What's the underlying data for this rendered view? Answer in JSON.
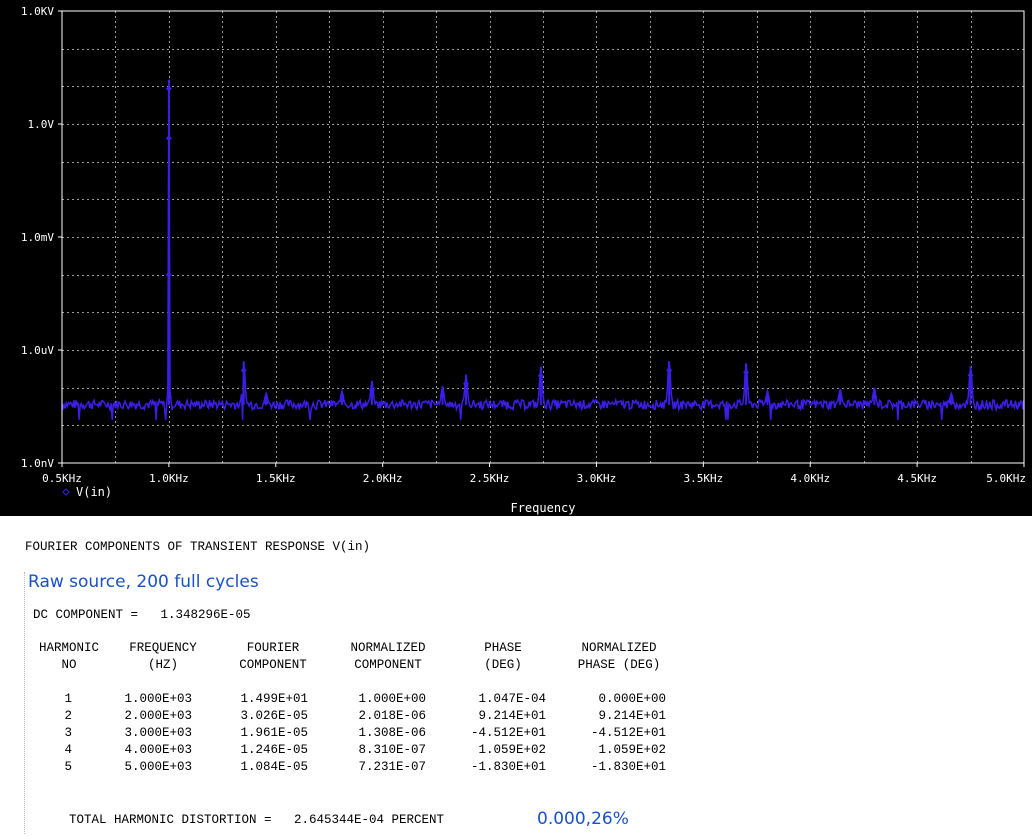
{
  "chart_data": {
    "type": "line",
    "title": "",
    "xlabel": "Frequency",
    "ylabel": "",
    "x_unit": "Hz",
    "y_scale": "log",
    "xlim": [
      500,
      5000
    ],
    "ylim": [
      1e-09,
      1000
    ],
    "x_ticks": [
      {
        "value": 500,
        "label": "0.5KHz"
      },
      {
        "value": 1000,
        "label": "1.0KHz"
      },
      {
        "value": 1500,
        "label": "1.5KHz"
      },
      {
        "value": 2000,
        "label": "2.0KHz"
      },
      {
        "value": 2500,
        "label": "2.5KHz"
      },
      {
        "value": 3000,
        "label": "3.0KHz"
      },
      {
        "value": 3500,
        "label": "3.5KHz"
      },
      {
        "value": 4000,
        "label": "4.0KHz"
      },
      {
        "value": 4500,
        "label": "4.5KHz"
      },
      {
        "value": 5000,
        "label": "5.0KHz"
      }
    ],
    "y_ticks": [
      {
        "value": 1000,
        "label": "1.0KV"
      },
      {
        "value": 1,
        "label": "1.0V"
      },
      {
        "value": 0.001,
        "label": "1.0mV"
      },
      {
        "value": 1e-06,
        "label": "1.0uV"
      },
      {
        "value": 1e-09,
        "label": "1.0nV"
      }
    ],
    "grid": true,
    "legend": "bottom-left",
    "series": [
      {
        "name": "V(in)",
        "color": "#3b1ee8",
        "noise_floor": 3.5e-08,
        "peaks": [
          {
            "x": 1000,
            "y": 15
          },
          {
            "x": 1350,
            "y": 5e-07
          },
          {
            "x": 1455,
            "y": 7e-08
          },
          {
            "x": 1810,
            "y": 8e-08
          },
          {
            "x": 1950,
            "y": 1.5e-07
          },
          {
            "x": 2280,
            "y": 1.1e-07
          },
          {
            "x": 2390,
            "y": 2.2e-07
          },
          {
            "x": 2740,
            "y": 3.6e-07
          },
          {
            "x": 3340,
            "y": 5e-07
          },
          {
            "x": 3700,
            "y": 4.4e-07
          },
          {
            "x": 3800,
            "y": 8e-08
          },
          {
            "x": 4140,
            "y": 9e-08
          },
          {
            "x": 4300,
            "y": 1e-07
          },
          {
            "x": 4660,
            "y": 7e-08
          },
          {
            "x": 4750,
            "y": 3.7e-07
          }
        ]
      }
    ]
  },
  "report": {
    "heading": "FOURIER COMPONENTS OF TRANSIENT RESPONSE V(in)",
    "note": "Raw source, 200 full cycles",
    "dc_component": "DC COMPONENT =   1.348296E-05",
    "headers_row1": [
      "HARMONIC",
      "FREQUENCY",
      "FOURIER",
      "NORMALIZED",
      "PHASE",
      "NORMALIZED"
    ],
    "headers_row2": [
      "NO",
      "(HZ)",
      "COMPONENT",
      "COMPONENT",
      "(DEG)",
      "PHASE (DEG)"
    ],
    "rows": [
      [
        "1",
        "1.000E+03",
        "1.499E+01",
        "1.000E+00",
        "1.047E-04",
        "0.000E+00"
      ],
      [
        "2",
        "2.000E+03",
        "3.026E-05",
        "2.018E-06",
        "9.214E+01",
        "9.214E+01"
      ],
      [
        "3",
        "3.000E+03",
        "1.961E-05",
        "1.308E-06",
        "-4.512E+01",
        "-4.512E+01"
      ],
      [
        "4",
        "4.000E+03",
        "1.246E-05",
        "8.310E-07",
        "1.059E+02",
        "1.059E+02"
      ],
      [
        "5",
        "5.000E+03",
        "1.084E-05",
        "7.231E-07",
        "-1.830E+01",
        "-1.830E+01"
      ]
    ],
    "thd_label": "TOTAL HARMONIC DISTORTION =   2.645344E-04 PERCENT",
    "thd_note": "0.000,26%"
  },
  "colors": {
    "plot_background": "#000000",
    "axis": "#ffffff",
    "grid": "#9a9a9a",
    "trace": "#3b1ee8",
    "note": "#1a50c8"
  }
}
